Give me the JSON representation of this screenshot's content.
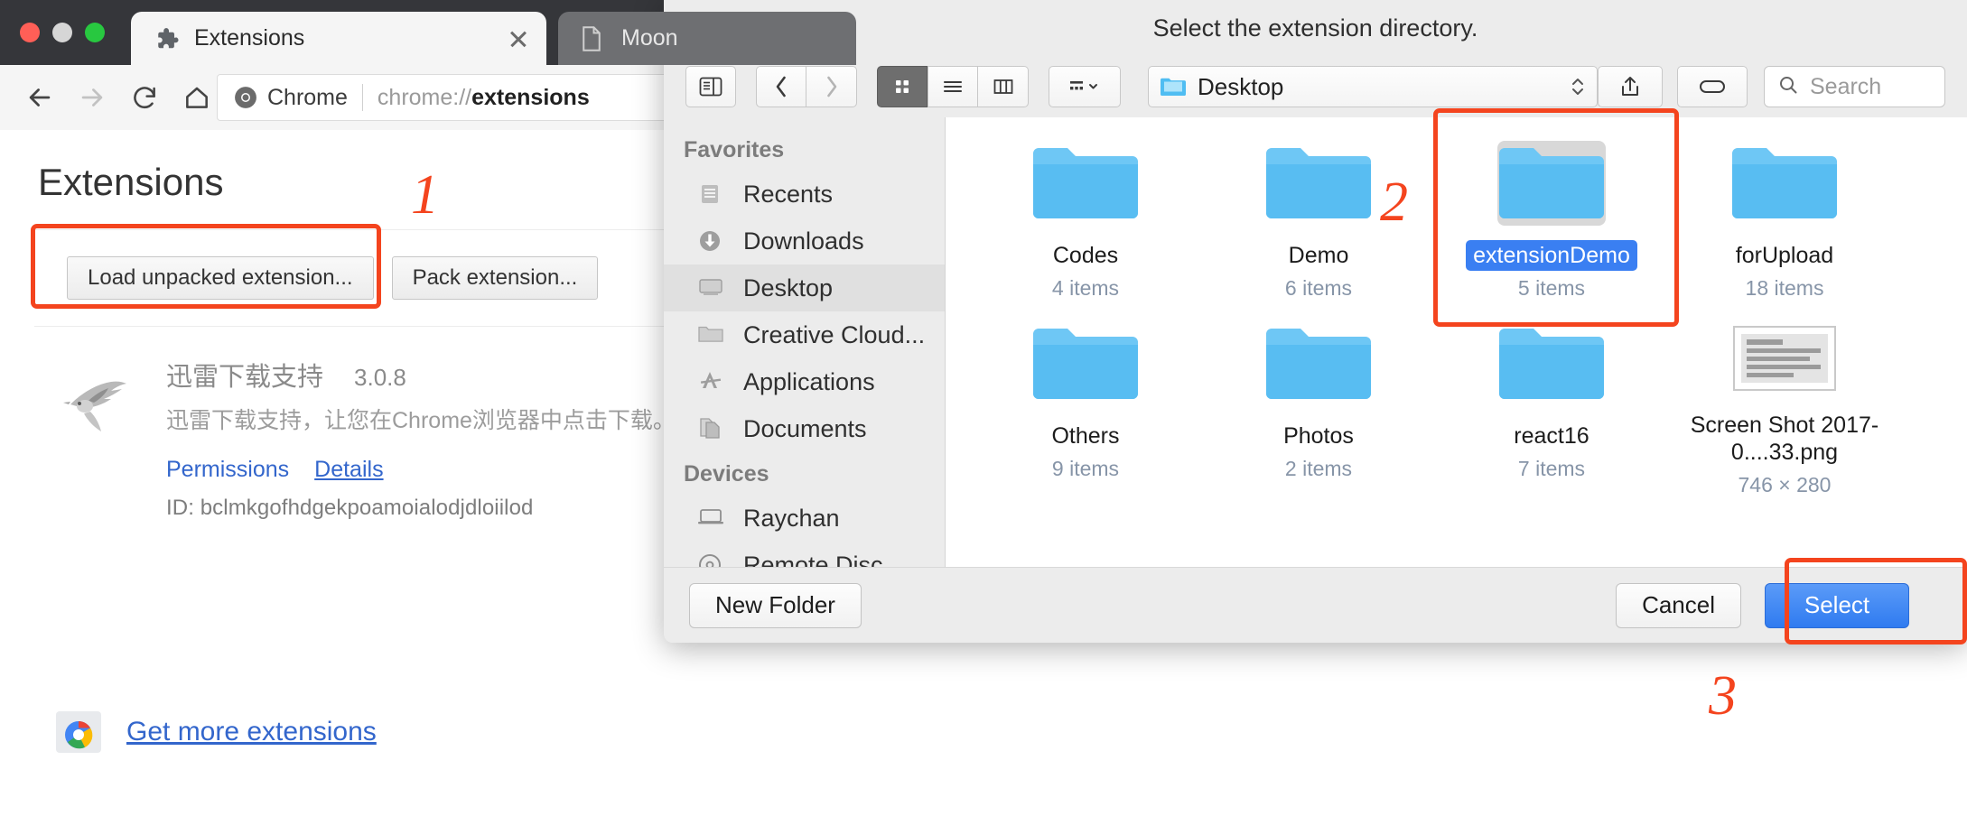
{
  "browser": {
    "tabs": [
      {
        "title": "Extensions",
        "icon": "puzzle-piece-icon",
        "active": true
      },
      {
        "title": "Moon",
        "icon": "page-icon",
        "active": false
      }
    ],
    "nav": {
      "back": "back-arrow-icon",
      "forward": "forward-arrow-icon",
      "reload": "reload-icon",
      "home": "home-icon"
    },
    "omnibox": {
      "chip_label": "Chrome",
      "url_prefix": "chrome://",
      "url_bold": "extensions"
    }
  },
  "extensions_page": {
    "title": "Extensions",
    "buttons": {
      "load_unpacked": "Load unpacked extension...",
      "pack_extension": "Pack extension..."
    },
    "items": [
      {
        "name": "迅雷下载支持",
        "version": "3.0.8",
        "description": "迅雷下载支持，让您在Chrome浏览器中点击下载。",
        "links": [
          "Permissions",
          "Details"
        ],
        "id_label": "ID: bclmkgofhdgekpoamoialodjdloiilod"
      }
    ],
    "get_more": "Get more extensions"
  },
  "dialog": {
    "title": "Select the extension directory.",
    "toolbar": {
      "sidebar_toggle": "sidebar-toggle-icon",
      "back": "back-chevron-icon",
      "forward": "forward-chevron-icon",
      "view_icon": "icon-view-icon",
      "view_list": "list-view-icon",
      "view_column": "column-view-icon",
      "arrange": "arrange-icon",
      "share": "share-icon",
      "tag": "tag-icon",
      "path_label": "Desktop",
      "search_placeholder": "Search"
    },
    "sidebar": {
      "sections": [
        {
          "header": "Favorites",
          "items": [
            {
              "label": "Recents",
              "icon": "recents-icon",
              "selected": false
            },
            {
              "label": "Downloads",
              "icon": "downloads-icon",
              "selected": false
            },
            {
              "label": "Desktop",
              "icon": "desktop-icon",
              "selected": true
            },
            {
              "label": "Creative Cloud...",
              "icon": "folder-icon",
              "selected": false
            },
            {
              "label": "Applications",
              "icon": "applications-icon",
              "selected": false
            },
            {
              "label": "Documents",
              "icon": "documents-icon",
              "selected": false
            }
          ]
        },
        {
          "header": "Devices",
          "items": [
            {
              "label": "Raychan",
              "icon": "laptop-icon",
              "selected": false
            },
            {
              "label": "Remote Disc",
              "icon": "disc-icon",
              "selected": false
            }
          ]
        }
      ]
    },
    "files": [
      {
        "name": "Codes",
        "sub": "4 items",
        "kind": "folder",
        "selected": false
      },
      {
        "name": "Demo",
        "sub": "6 items",
        "kind": "folder",
        "selected": false
      },
      {
        "name": "extensionDemo",
        "sub": "5 items",
        "kind": "folder",
        "selected": true
      },
      {
        "name": "forUpload",
        "sub": "18 items",
        "kind": "folder",
        "selected": false
      },
      {
        "name": "Others",
        "sub": "9 items",
        "kind": "folder",
        "selected": false
      },
      {
        "name": "Photos",
        "sub": "2 items",
        "kind": "folder",
        "selected": false
      },
      {
        "name": "react16",
        "sub": "7 items",
        "kind": "folder",
        "selected": false
      },
      {
        "name": "Screen Shot 2017-0....33.png",
        "sub": "746 × 280",
        "kind": "image",
        "selected": false
      }
    ],
    "footer": {
      "new_folder": "New Folder",
      "cancel": "Cancel",
      "select": "Select"
    }
  },
  "annotations": {
    "step1": "1",
    "step2": "2",
    "step3": "3",
    "color": "#f4441e"
  }
}
